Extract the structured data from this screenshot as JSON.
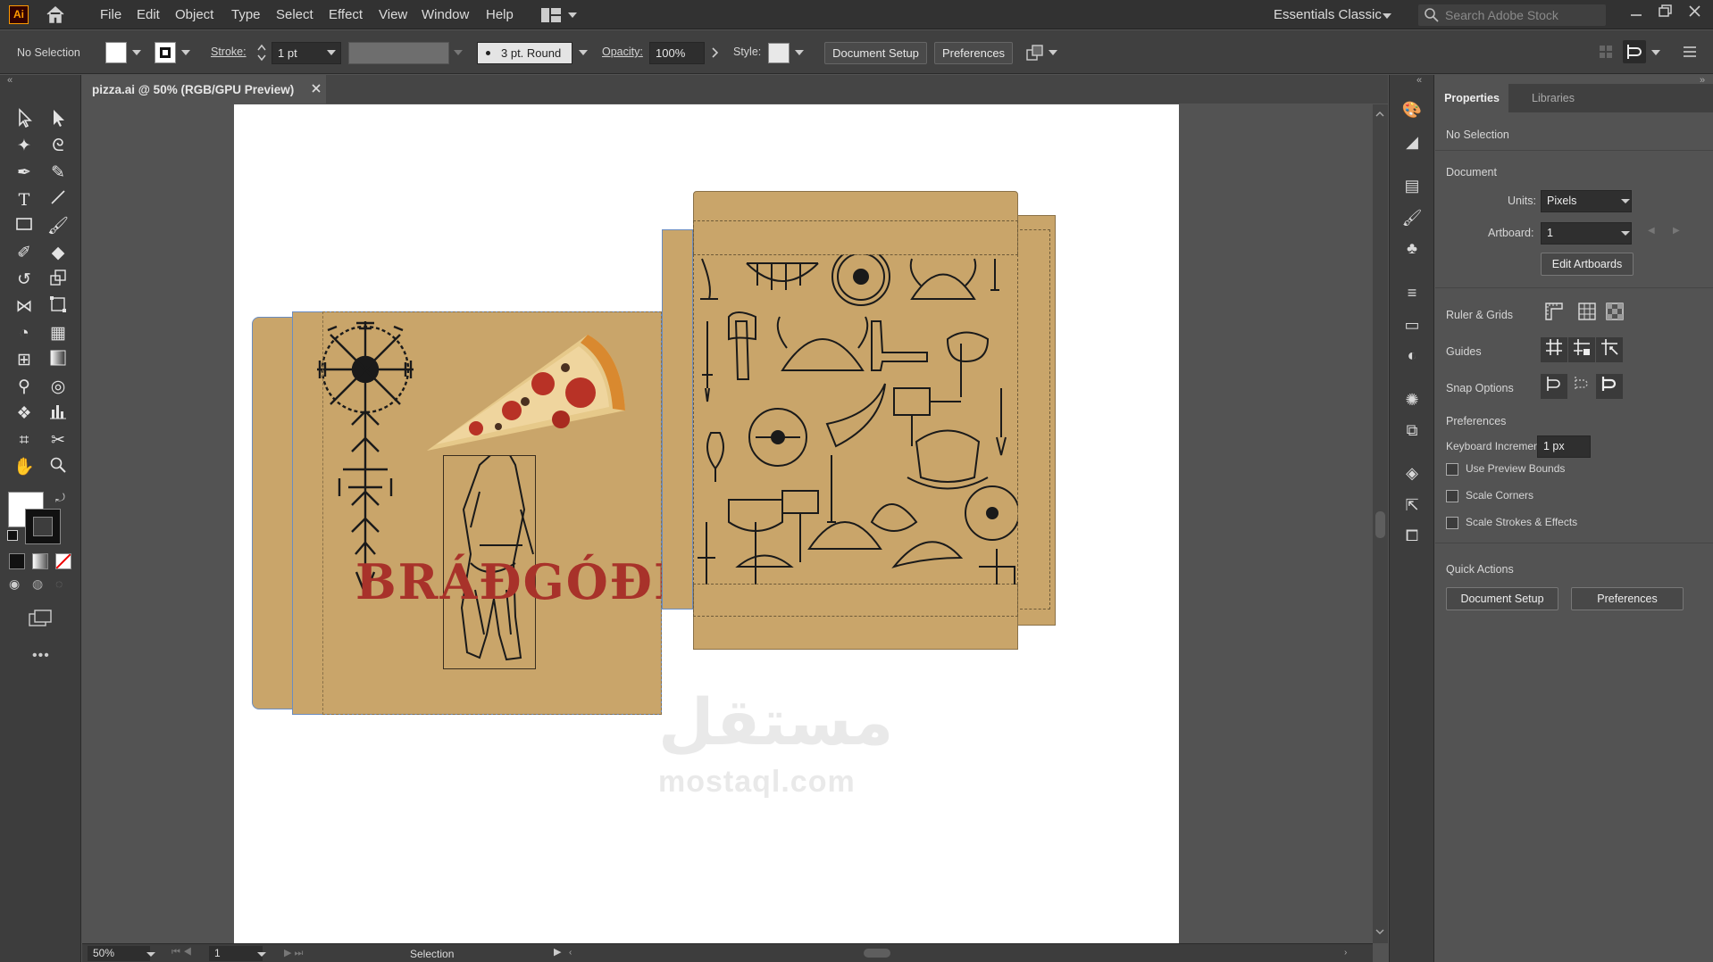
{
  "app": {
    "logo": "Ai"
  },
  "menu": [
    "File",
    "Edit",
    "Object",
    "Type",
    "Select",
    "Effect",
    "View",
    "Window",
    "Help"
  ],
  "workspace": "Essentials Classic",
  "search": {
    "placeholder": "Search Adobe Stock"
  },
  "control": {
    "selection": "No Selection",
    "stroke_label": "Stroke:",
    "stroke_value": "1 pt",
    "brush": "3 pt. Round",
    "opacity_label": "Opacity:",
    "opacity_value": "100%",
    "style_label": "Style:",
    "doc_setup": "Document Setup",
    "preferences": "Preferences"
  },
  "document": {
    "tab_title": "pizza.ai @ 50% (RGB/GPU Preview)"
  },
  "artwork": {
    "brand_text": "BRÁÐGÓÐR"
  },
  "watermark": {
    "arabic": "مستقل",
    "latin": "mostaql.com"
  },
  "status": {
    "zoom": "50%",
    "artboard": "1",
    "tool": "Selection"
  },
  "panel": {
    "tabs": [
      "Properties",
      "Libraries"
    ],
    "selection": "No Selection",
    "document_title": "Document",
    "units_label": "Units:",
    "units_value": "Pixels",
    "artboard_label": "Artboard:",
    "artboard_value": "1",
    "edit_artboards": "Edit Artboards",
    "rulers": "Ruler & Grids",
    "guides": "Guides",
    "snap": "Snap Options",
    "prefs_title": "Preferences",
    "keyboard_label": "Keyboard Increment:",
    "keyboard_value": "1 px",
    "checkboxes": [
      "Use Preview Bounds",
      "Scale Corners",
      "Scale Strokes & Effects"
    ],
    "quick_actions": "Quick Actions",
    "qa_doc_setup": "Document Setup",
    "qa_preferences": "Preferences"
  },
  "colors": {
    "kraft": "#c9a56a",
    "brand_red": "#a8322a",
    "ui_dark": "#323232"
  }
}
